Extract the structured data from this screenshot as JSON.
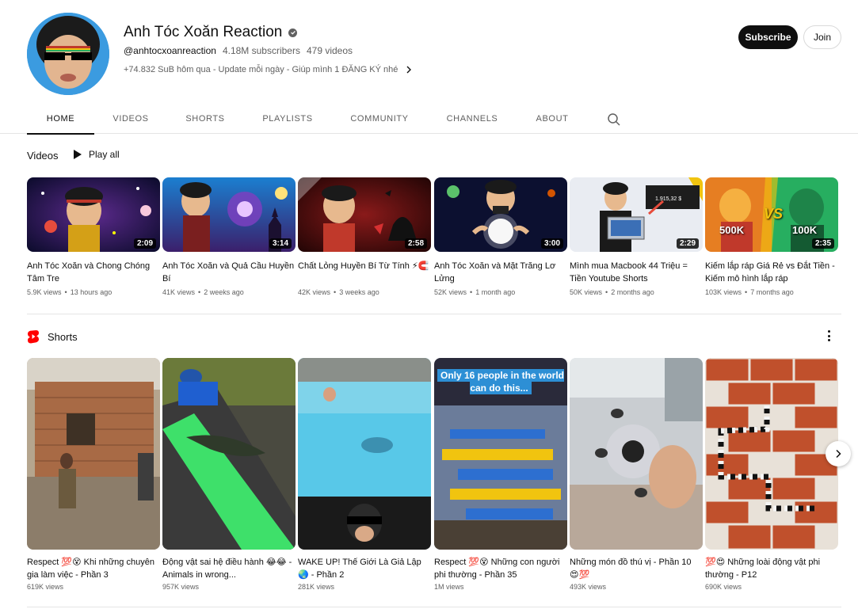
{
  "channel": {
    "name": "Anh Tóc Xoăn Reaction",
    "handle": "@anhtocxoanreaction",
    "subscribers": "4.18M subscribers",
    "videos_count": "479 videos",
    "description": "+74.832 SuB hôm qua - Update mỗi ngày - Giúp mình 1 ĐĂNG KÝ nhé",
    "subscribe_label": "Subscribe",
    "join_label": "Join"
  },
  "tabs": [
    "HOME",
    "VIDEOS",
    "SHORTS",
    "PLAYLISTS",
    "COMMUNITY",
    "CHANNELS",
    "ABOUT"
  ],
  "videos_section": {
    "title": "Videos",
    "play_all": "Play all",
    "items": [
      {
        "title": "Anh Tóc Xoăn và Chong Chóng Tâm Tre",
        "duration": "2:09",
        "views": "5.9K views",
        "age": "13 hours ago"
      },
      {
        "title": "Anh Tóc Xoăn và Quả Cầu Huyền Bí",
        "duration": "3:14",
        "views": "41K views",
        "age": "2 weeks ago"
      },
      {
        "title": "Chất Lỏng Huyền Bí Từ Tính ⚡🧲",
        "duration": "2:58",
        "views": "42K views",
        "age": "3 weeks ago"
      },
      {
        "title": "Anh Tóc Xoăn và Mặt Trăng Lơ Lửng",
        "duration": "3:00",
        "views": "52K views",
        "age": "1 month ago"
      },
      {
        "title": "Mình mua Macbook 44 Triệu = Tiền Youtube Shorts",
        "duration": "2:29",
        "views": "50K views",
        "age": "2 months ago"
      },
      {
        "title": "Kiếm lắp ráp Giá Rẻ vs Đắt Tiền - Kiếm mô hình lắp ráp",
        "duration": "2:35",
        "views": "103K views",
        "age": "7 months ago"
      }
    ],
    "thumb_texts": {
      "price": "1.915,32 $",
      "left_num": "500K",
      "vs": "VS",
      "right_num": "100K"
    }
  },
  "shorts_section": {
    "title": "Shorts",
    "overlay": "Only 16 people in the world can do this...",
    "items": [
      {
        "title": "Respect 💯😵 Khi những chuyên gia làm việc - Phần 3",
        "views": "619K views"
      },
      {
        "title": "Động vật sai hệ điều hành 😂😂 - Animals in wrong...",
        "views": "957K views"
      },
      {
        "title": "WAKE UP! Thế Giới Là Giả Lập 🌏 - Phần 2",
        "views": "281K views"
      },
      {
        "title": "Respect 💯😵 Những con người phi thường - Phần 35",
        "views": "1M views"
      },
      {
        "title": "Những món đồ thú vị - Phần 10 😍💯",
        "views": "493K views"
      },
      {
        "title": "💯😍 Những loài động vật phi thường - P12",
        "views": "690K views"
      }
    ]
  },
  "colors": {
    "accent": "#0f0f0f",
    "shorts_red": "#ff0000",
    "muted": "#606060"
  }
}
